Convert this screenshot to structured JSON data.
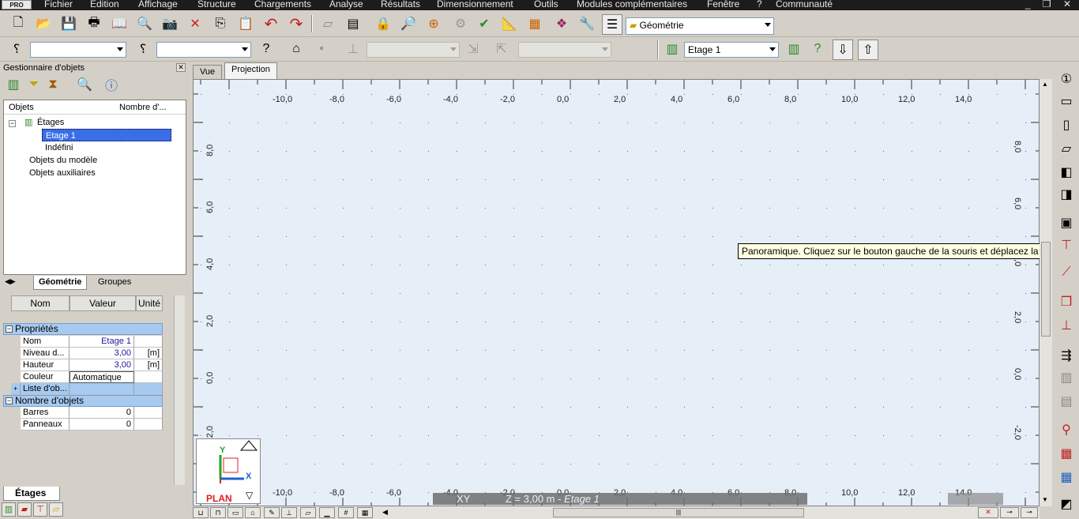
{
  "menubar": {
    "logo": "PRO",
    "items": [
      "Fichier",
      "Edition",
      "Affichage",
      "Structure",
      "Chargements",
      "Analyse",
      "Résultats",
      "Dimensionnement",
      "Outils",
      "Modules complémentaires",
      "Fenêtre",
      "?",
      "Communauté"
    ]
  },
  "toolbar1": {
    "mode_combo": "Géométrie"
  },
  "toolbar2": {
    "combo1": "",
    "combo2": "",
    "combo3": "",
    "combo4": "",
    "level_combo": "Etage 1"
  },
  "object_manager": {
    "title": "Gestionnaire d'objets",
    "columns": [
      "Objets",
      "Nombre d'..."
    ],
    "tree": {
      "root": "Étages",
      "selected": "Etage 1",
      "child2": "Indéfini",
      "model_objects": "Objets du modèle",
      "aux_objects": "Objets auxiliaires"
    },
    "tabs": [
      "Géométrie",
      "Groupes"
    ]
  },
  "properties": {
    "headers": [
      "Nom",
      "Valeur",
      "Unité"
    ],
    "section1": "Propriétés",
    "rows1": [
      {
        "name": "Nom",
        "value": "Etage 1",
        "unit": ""
      },
      {
        "name": "Niveau d...",
        "value": "3,00",
        "unit": "[m]"
      },
      {
        "name": "Hauteur",
        "value": "3,00",
        "unit": "[m]"
      },
      {
        "name": "Couleur",
        "value": "Automatique",
        "unit": ""
      },
      {
        "name": "Liste d'ob...",
        "value": "",
        "unit": ""
      }
    ],
    "section2": "Nombre d'objets",
    "rows2": [
      {
        "name": "Barres",
        "value": "0",
        "unit": ""
      },
      {
        "name": "Panneaux",
        "value": "0",
        "unit": ""
      }
    ],
    "bottom_tab": "Étages"
  },
  "view": {
    "tabs": [
      "Vue",
      "Projection"
    ],
    "active_tab": "Projection",
    "x_ticks": [
      "-10,0",
      "-8,0",
      "-6,0",
      "-4,0",
      "-2,0",
      "0,0",
      "2,0",
      "4,0",
      "6,0",
      "8,0",
      "10,0",
      "12,0",
      "14,0"
    ],
    "y_ticks": [
      "8,0",
      "6,0",
      "4,0",
      "2,0",
      "0,0",
      "-2,0"
    ],
    "tooltip": "Panoramique. Cliquez sur le bouton gauche de la souris et déplacez la vue de st",
    "plan_label": "PLAN",
    "axis_y": "Y",
    "axis_x": "X",
    "status_xy": "XY",
    "status_z": "Z = 3,00 m - ",
    "status_level": "Etage 1"
  },
  "colors": {
    "view_bg": "#e6eef8",
    "selection": "#3a6ee8",
    "section_bg": "#a6caf0",
    "menubar_bg": "#1c1c1c"
  }
}
